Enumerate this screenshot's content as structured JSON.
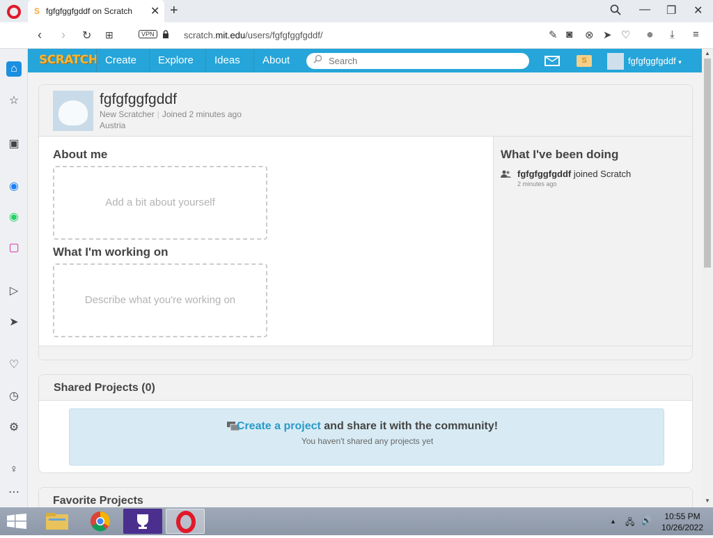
{
  "browser": {
    "tab_title": "fgfgfggfgddf on Scratch",
    "tab_favicon": "S",
    "url_host_prefix": "scratch.",
    "url_host": "mit.edu",
    "url_path": "/users/fgfgfggfgddf/",
    "vpn_label": "VPN"
  },
  "scratch_nav": {
    "logo": "SCRATCH",
    "links": [
      "Create",
      "Explore",
      "Ideas",
      "About"
    ],
    "search_placeholder": "Search",
    "mystuff_glyph": "S",
    "username": "fgfgfggfgddf"
  },
  "profile": {
    "username": "fgfgfggfgddf",
    "status": "New Scratcher",
    "joined": "Joined 2 minutes ago",
    "country": "Austria",
    "about_title": "About me",
    "about_placeholder": "Add a bit about yourself",
    "working_title": "What I'm working on",
    "working_placeholder": "Describe what you're working on",
    "activity_title": "What I've been doing",
    "activity_user": "fgfgfggfgddf",
    "activity_action": "joined Scratch",
    "activity_time": "2 minutes ago"
  },
  "shared": {
    "title": "Shared Projects (0)",
    "link": "Create a project",
    "tail": "and share it with the community!",
    "sub": "You haven't shared any projects yet"
  },
  "favorites": {
    "title": "Favorite Projects"
  },
  "taskbar": {
    "time": "10:55 PM",
    "date": "10/26/2022"
  },
  "colors": {
    "scratch_blue": "#25a5d9",
    "opera_red": "#e0192a",
    "link_blue": "#2a9ac9"
  }
}
